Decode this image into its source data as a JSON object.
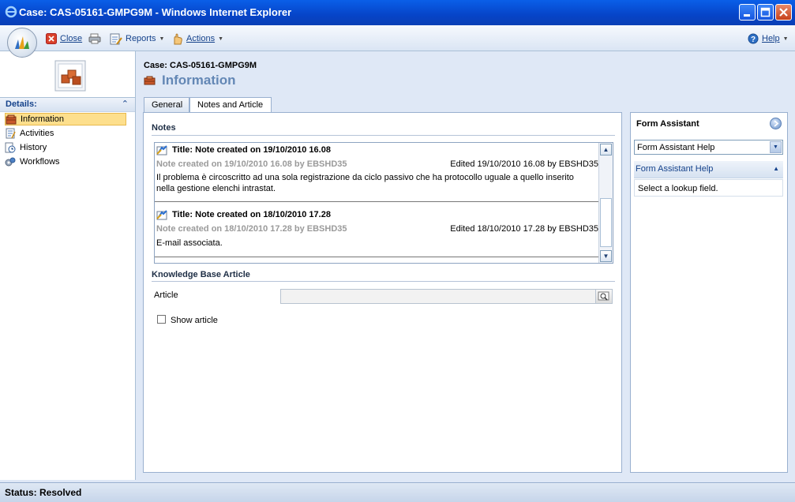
{
  "window": {
    "title": "Case: CAS-05161-GMPG9M - Windows Internet Explorer"
  },
  "toolbar": {
    "close_label": "Close",
    "reports_label": "Reports",
    "actions_label": "Actions",
    "help_label": "Help"
  },
  "nav": {
    "header": "Details:",
    "items": [
      {
        "label": "Information",
        "icon": "information-icon",
        "selected": true
      },
      {
        "label": "Activities",
        "icon": "activities-icon"
      },
      {
        "label": "History",
        "icon": "history-icon"
      },
      {
        "label": "Workflows",
        "icon": "workflows-icon"
      }
    ]
  },
  "record": {
    "case_line": "Case: CAS-05161-GMPG9M",
    "section_title": "Information"
  },
  "tabs": [
    {
      "label": "General",
      "active": false
    },
    {
      "label": "Notes and Article",
      "active": true
    }
  ],
  "notes": {
    "header": "Notes",
    "items": [
      {
        "title": "Title: Note created on 19/10/2010 16.08",
        "meta": "Note created on 19/10/2010 16.08 by EBSHD35",
        "edited": "Edited 19/10/2010 16.08 by EBSHD35",
        "body": "Il problema è circoscritto ad una sola registrazione da ciclo passivo che ha protocollo uguale a quello inserito nella gestione elenchi intrastat."
      },
      {
        "title": "Title: Note created on 18/10/2010 17.28",
        "meta": "Note created on 18/10/2010 17.28 by EBSHD35",
        "edited": "Edited 18/10/2010 17.28 by EBSHD35",
        "body": "E-mail associata."
      }
    ]
  },
  "kb": {
    "header": "Knowledge Base Article",
    "article_label": "Article",
    "article_value": "",
    "show_article_label": "Show article",
    "show_article_checked": false
  },
  "form_assistant": {
    "title": "Form Assistant",
    "select_value": "Form Assistant Help",
    "subheader": "Form Assistant Help",
    "content": "Select a lookup field."
  },
  "status": {
    "text": "Status: Resolved"
  }
}
